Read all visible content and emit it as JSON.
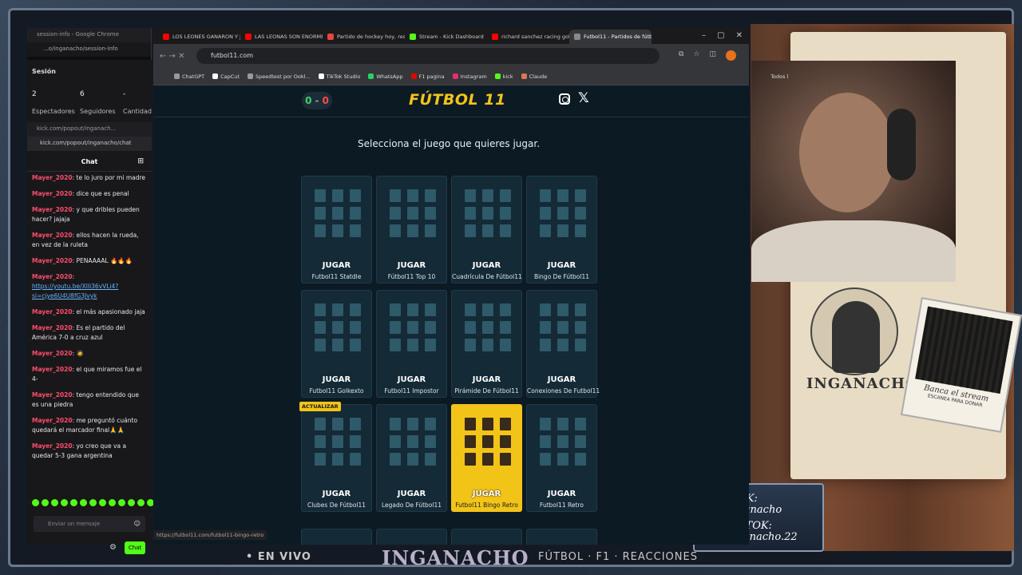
{
  "stream": {
    "live_label": "• EN VIVO",
    "streamer_name": "INGANACHO",
    "tags": "FÚTBOL · F1 · REACCIONES",
    "logo_text": "INGANACHO",
    "qr_caption": "Banca el stream",
    "qr_sub": "ESCANEA PARA DONAR",
    "kick_label": "KICK: Inganacho",
    "tiktok_label_1": "TIKTOK:",
    "tiktok_label_2": "inganacho.22"
  },
  "chat_window": {
    "title": "session-info - Google Chrome",
    "url": "...o/inganacho/session-info",
    "session_title": "Sesión",
    "stats": [
      {
        "value": "2",
        "label": "Espectadores"
      },
      {
        "value": "6",
        "label": "Seguidores"
      },
      {
        "value": "-",
        "label": "Cantidad de"
      }
    ],
    "popout_url": "kick.com/popout/inganach...",
    "popout_addr": "kick.com/popout/inganacho/chat",
    "header": "Chat",
    "messages": [
      {
        "user": "Mayer_2020",
        "text": ": te lo juro por mi madre"
      },
      {
        "user": "Mayer_2020",
        "text": ": dice que es penal"
      },
      {
        "user": "Mayer_2020",
        "text": ": y que dribles pueden hacer? jajaja"
      },
      {
        "user": "Mayer_2020",
        "text": ": ellos hacen la rueda, en vez de la ruleta"
      },
      {
        "user": "Mayer_2020",
        "text": ": PENAAAAL 🔥🔥🔥"
      },
      {
        "user": "Mayer_2020",
        "text": ":",
        "link": "https://youtu.be/XlIi36vVLi4?si=cjye6U4U8fG3Jvyk"
      },
      {
        "user": "Mayer_2020",
        "text": ": el más apasionado jaja"
      },
      {
        "user": "Mayer_2020",
        "text": ": Es el partido del América 7-0 a cruz azul"
      },
      {
        "user": "Mayer_2020",
        "text": ": 🧔"
      },
      {
        "user": "Mayer_2020",
        "text": ": el que miramos fue el 4-"
      },
      {
        "user": "Mayer_2020",
        "text": ": tengo entendido que es una piedra"
      },
      {
        "user": "Mayer_2020",
        "text": ": me preguntó cuánto quedará el marcador final🙏🙏"
      },
      {
        "user": "Mayer_2020",
        "text": ": yo creo que va a quedar 5-3 gana argentina"
      }
    ],
    "input_placeholder": "Enviar un mensaje",
    "chat_button": "Chat"
  },
  "browser": {
    "tabs": [
      {
        "label": "LOS LEONES GANARON Y J...",
        "color": "#ff0000"
      },
      {
        "label": "LAS LEONAS SON ENORME...",
        "color": "#ff0000"
      },
      {
        "label": "Partido de hockey hoy, resu...",
        "color": "#e8453c"
      },
      {
        "label": "Stream - Kick Dashboard",
        "color": "#53fc18"
      },
      {
        "label": "richard sanchez racing gole...",
        "color": "#ff0000"
      },
      {
        "label": "Futbol11 - Partidos de fútb...",
        "color": "#888888",
        "active": true
      }
    ],
    "url": "futbol11.com",
    "bookmarks": [
      {
        "label": "ChatGPT",
        "color": "#999"
      },
      {
        "label": "CapCut",
        "color": "#fff"
      },
      {
        "label": "Speedtest por Ookl...",
        "color": "#999"
      },
      {
        "label": "TikTok Studio",
        "color": "#fff"
      },
      {
        "label": "WhatsApp",
        "color": "#25d366"
      },
      {
        "label": "F1 pagina",
        "color": "#e10600"
      },
      {
        "label": "Instagram",
        "color": "#e1306c"
      },
      {
        "label": "kick",
        "color": "#53fc18"
      },
      {
        "label": "Claude",
        "color": "#d97757"
      }
    ],
    "all_bookmarks": "Todos l",
    "status_url": "https://futbol11.com/futbol11-bingo-retro"
  },
  "site": {
    "score_home": "0",
    "score_sep": "-",
    "score_away": "0",
    "logo": "FÚTBOL 11",
    "prompt": "Selecciona el juego que quieres jugar.",
    "play_label": "JUGAR",
    "update_badge": "ACTUALIZAR",
    "games": [
      "Futbol11 Statdle",
      "Fútbol11 Top 10",
      "Cuadrícula De Fútbol11",
      "Bingo De Fútbol11",
      "Futbol11 Golkexto",
      "Futbol11 Impostor",
      "Pirámide De Fútbol11",
      "Conexiones De Futbol11",
      "Clubes De Fútbol11",
      "Legado De Fútbol11",
      "Futbol11 Bingo Retro",
      "Futbol11 Retro"
    ],
    "colors": {
      "accent": "#f2c418",
      "bg": "#0c1a24",
      "card": "#142a36"
    }
  }
}
